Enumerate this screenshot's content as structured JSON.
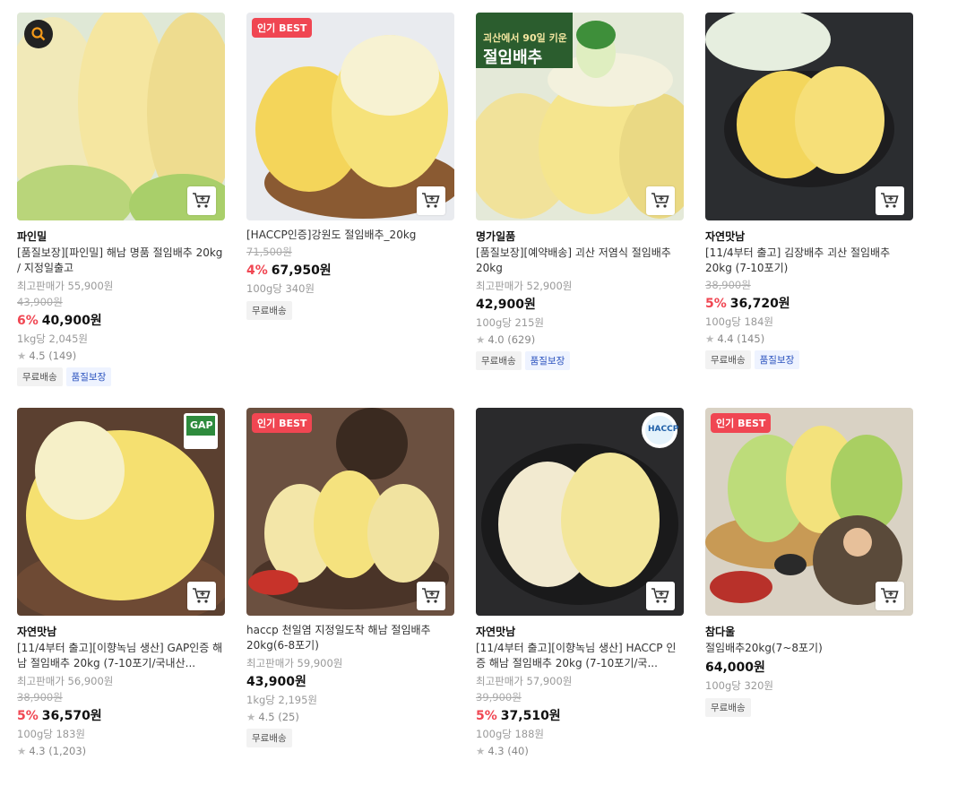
{
  "colors": {
    "discount": "#f04652",
    "badge": "#f04652",
    "tag_blue": "#2a52be"
  },
  "products": [
    {
      "brand": "파인밀",
      "name": "[품질보장][파인밀] 해남 명품 절임배추 20kg / 지정일출고",
      "ref_price": "최고판매가 55,900원",
      "orig_price": "43,900원",
      "discount": "6%",
      "price": "40,900원",
      "unit_price": "1kg당 2,045원",
      "rating": "4.5 (149)",
      "tags": [
        "무료배송",
        "품질보장"
      ],
      "badge": "",
      "overlay_text": ""
    },
    {
      "brand": "",
      "name": "[HACCP인증]강원도 절임배추_20kg",
      "ref_price": "",
      "orig_price": "71,500원",
      "discount": "4%",
      "price": "67,950원",
      "unit_price": "100g당 340원",
      "rating": "",
      "tags": [
        "무료배송"
      ],
      "badge": "인기 BEST",
      "overlay_text": ""
    },
    {
      "brand": "명가일품",
      "name": "[품질보장][예약배송] 괴산 저염식 절임배추 20kg",
      "ref_price": "최고판매가 52,900원",
      "orig_price": "",
      "discount": "",
      "price": "42,900원",
      "unit_price": "100g당 215원",
      "rating": "4.0 (629)",
      "tags": [
        "무료배송",
        "품질보장"
      ],
      "badge": "",
      "overlay_text": "괴산에서 90일 키운",
      "overlay_title": "절임배추"
    },
    {
      "brand": "자연맛남",
      "name": "[11/4부터 출고] 김장배추 괴산 절임배추 20kg (7-10포기)",
      "ref_price": "",
      "orig_price": "38,900원",
      "discount": "5%",
      "price": "36,720원",
      "unit_price": "100g당 184원",
      "rating": "4.4 (145)",
      "tags": [
        "무료배송",
        "품질보장"
      ],
      "badge": "",
      "overlay_text": ""
    },
    {
      "brand": "자연맛남",
      "name": "[11/4부터 출고][이향녹님 생산] GAP인증 해남 절임배추 20kg (7-10포기/국내산...",
      "ref_price": "최고판매가 56,900원",
      "orig_price": "38,900원",
      "discount": "5%",
      "price": "36,570원",
      "unit_price": "100g당 183원",
      "rating": "4.3 (1,203)",
      "tags": [],
      "badge": "",
      "overlay_text": "GAP"
    },
    {
      "brand": "",
      "name": "haccp 천일염 지정일도착 해남 절임배추 20kg(6-8포기)",
      "ref_price": "최고판매가 59,900원",
      "orig_price": "",
      "discount": "",
      "price": "43,900원",
      "unit_price": "1kg당 2,195원",
      "rating": "4.5 (25)",
      "tags": [
        "무료배송"
      ],
      "badge": "인기 BEST",
      "overlay_text": ""
    },
    {
      "brand": "자연맛남",
      "name": "[11/4부터 출고][이향녹님 생산] HACCP 인증 해남 절임배추 20kg (7-10포기/국...",
      "ref_price": "최고판매가 57,900원",
      "orig_price": "39,900원",
      "discount": "5%",
      "price": "37,510원",
      "unit_price": "100g당 188원",
      "rating": "4.3 (40)",
      "tags": [],
      "badge": "",
      "overlay_text": "HACCP"
    },
    {
      "brand": "참다울",
      "name": "절임배추20kg(7~8포기)",
      "ref_price": "",
      "orig_price": "",
      "discount": "",
      "price": "64,000원",
      "unit_price": "100g당 320원",
      "rating": "",
      "tags": [
        "무료배송"
      ],
      "badge": "인기 BEST",
      "overlay_text": ""
    }
  ]
}
